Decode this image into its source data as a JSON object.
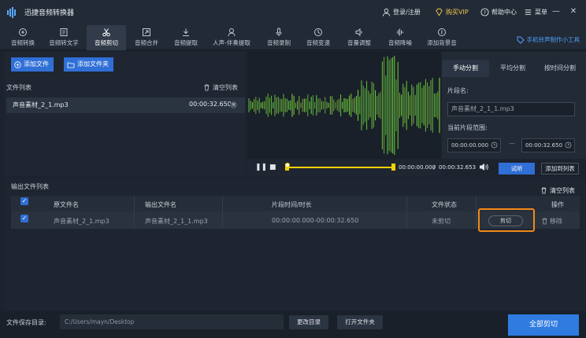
{
  "app": {
    "title": "迅捷音频转换器",
    "login": "登录/注册",
    "vip": "购买VIP",
    "help": "帮助中心",
    "menu": "菜单",
    "colors": {
      "accent": "#2f6fd6",
      "vip": "#f2c94c",
      "highlight": "#f08a17",
      "wave": "#6fd84a"
    }
  },
  "toolbar": {
    "items": [
      {
        "label": "音频转换",
        "icon": "convert-icon"
      },
      {
        "label": "音频转文字",
        "icon": "text-icon"
      },
      {
        "label": "音频剪切",
        "icon": "scissors-icon"
      },
      {
        "label": "音频合并",
        "icon": "merge-icon"
      },
      {
        "label": "音频提取",
        "icon": "extract-icon"
      },
      {
        "label": "人声-伴奏提取",
        "icon": "vocal-icon"
      },
      {
        "label": "音频录制",
        "icon": "mic-icon"
      },
      {
        "label": "音频变速",
        "icon": "speed-icon"
      },
      {
        "label": "音量调整",
        "icon": "volume-icon"
      },
      {
        "label": "音频降噪",
        "icon": "denoise-icon"
      },
      {
        "label": "添加背景音",
        "icon": "bgm-icon"
      }
    ],
    "active_index": 2,
    "ringtone": "手机铃声制作小工具"
  },
  "files": {
    "add_file": "添加文件",
    "add_folder": "添加文件夹",
    "list_title": "文件列表",
    "clear_list": "清空列表",
    "items": [
      {
        "name": "声音素材_2_1.mp3",
        "duration": "00:00:32.650"
      }
    ]
  },
  "player": {
    "current_time": "00:00:00.000",
    "separator": "/",
    "total_time": "00:00:32.653",
    "preview": "试听",
    "add_to_list": "添加到列表"
  },
  "split": {
    "tabs": [
      "手动分割",
      "平均分割",
      "按时间分割"
    ],
    "active_tab": 0,
    "segment_name_label": "片段名:",
    "segment_name": "声音素材_2_1_1.mp3",
    "range_label": "当前片段范围:",
    "range_start": "00:00:00.000",
    "range_dash": "—",
    "range_end": "00:00:32.650"
  },
  "output": {
    "title": "输出文件列表",
    "clear_list": "清空列表",
    "columns": [
      "原文件名",
      "输出文件名",
      "片段时间/时长",
      "文件状态",
      "操作"
    ],
    "rows": [
      {
        "source": "声音素材_2_1.mp3",
        "output": "声音素材_2_1_1.mp3",
        "time": "00:00:00.000-00:00:32.650",
        "status": "未剪切",
        "cut": "剪切",
        "remove": "移除"
      }
    ]
  },
  "footer": {
    "save_label": "文件保存目录:",
    "save_path": "C:/Users/mayn/Desktop",
    "change_dir": "更改目录",
    "open_folder": "打开文件夹",
    "cut_all": "全部剪切"
  }
}
